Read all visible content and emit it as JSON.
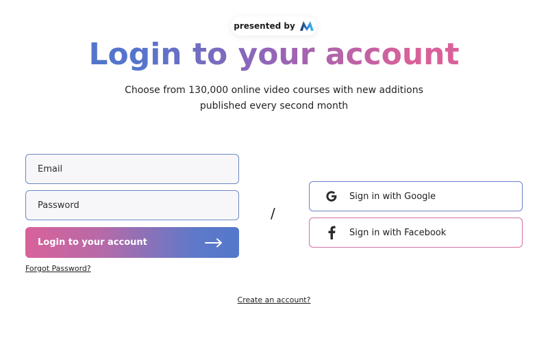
{
  "header": {
    "presented_by": "presented by",
    "brand_logo": "M-logo-icon",
    "title": "Login to your account",
    "subtitle_line1": "Choose from 130,000 online video courses with new additions",
    "subtitle_line2": "published every second month"
  },
  "form": {
    "email_placeholder": "Email",
    "password_placeholder": "Password",
    "login_label": "Login to your account",
    "login_icon": "arrow-right-icon",
    "forgot_label": "Forgot Password?"
  },
  "divider": "/",
  "social": {
    "google_label": "Sign in with Google",
    "google_icon": "google-icon",
    "facebook_label": "Sign in with Facebook",
    "facebook_icon": "facebook-icon"
  },
  "footer": {
    "create_account_label": "Create an account?"
  },
  "colors": {
    "gradient_blue": "#5475cc",
    "gradient_purple": "#9565b5",
    "gradient_pink": "#d9619a",
    "input_border": "#6c86c7",
    "input_bg": "#f7f7f9"
  }
}
